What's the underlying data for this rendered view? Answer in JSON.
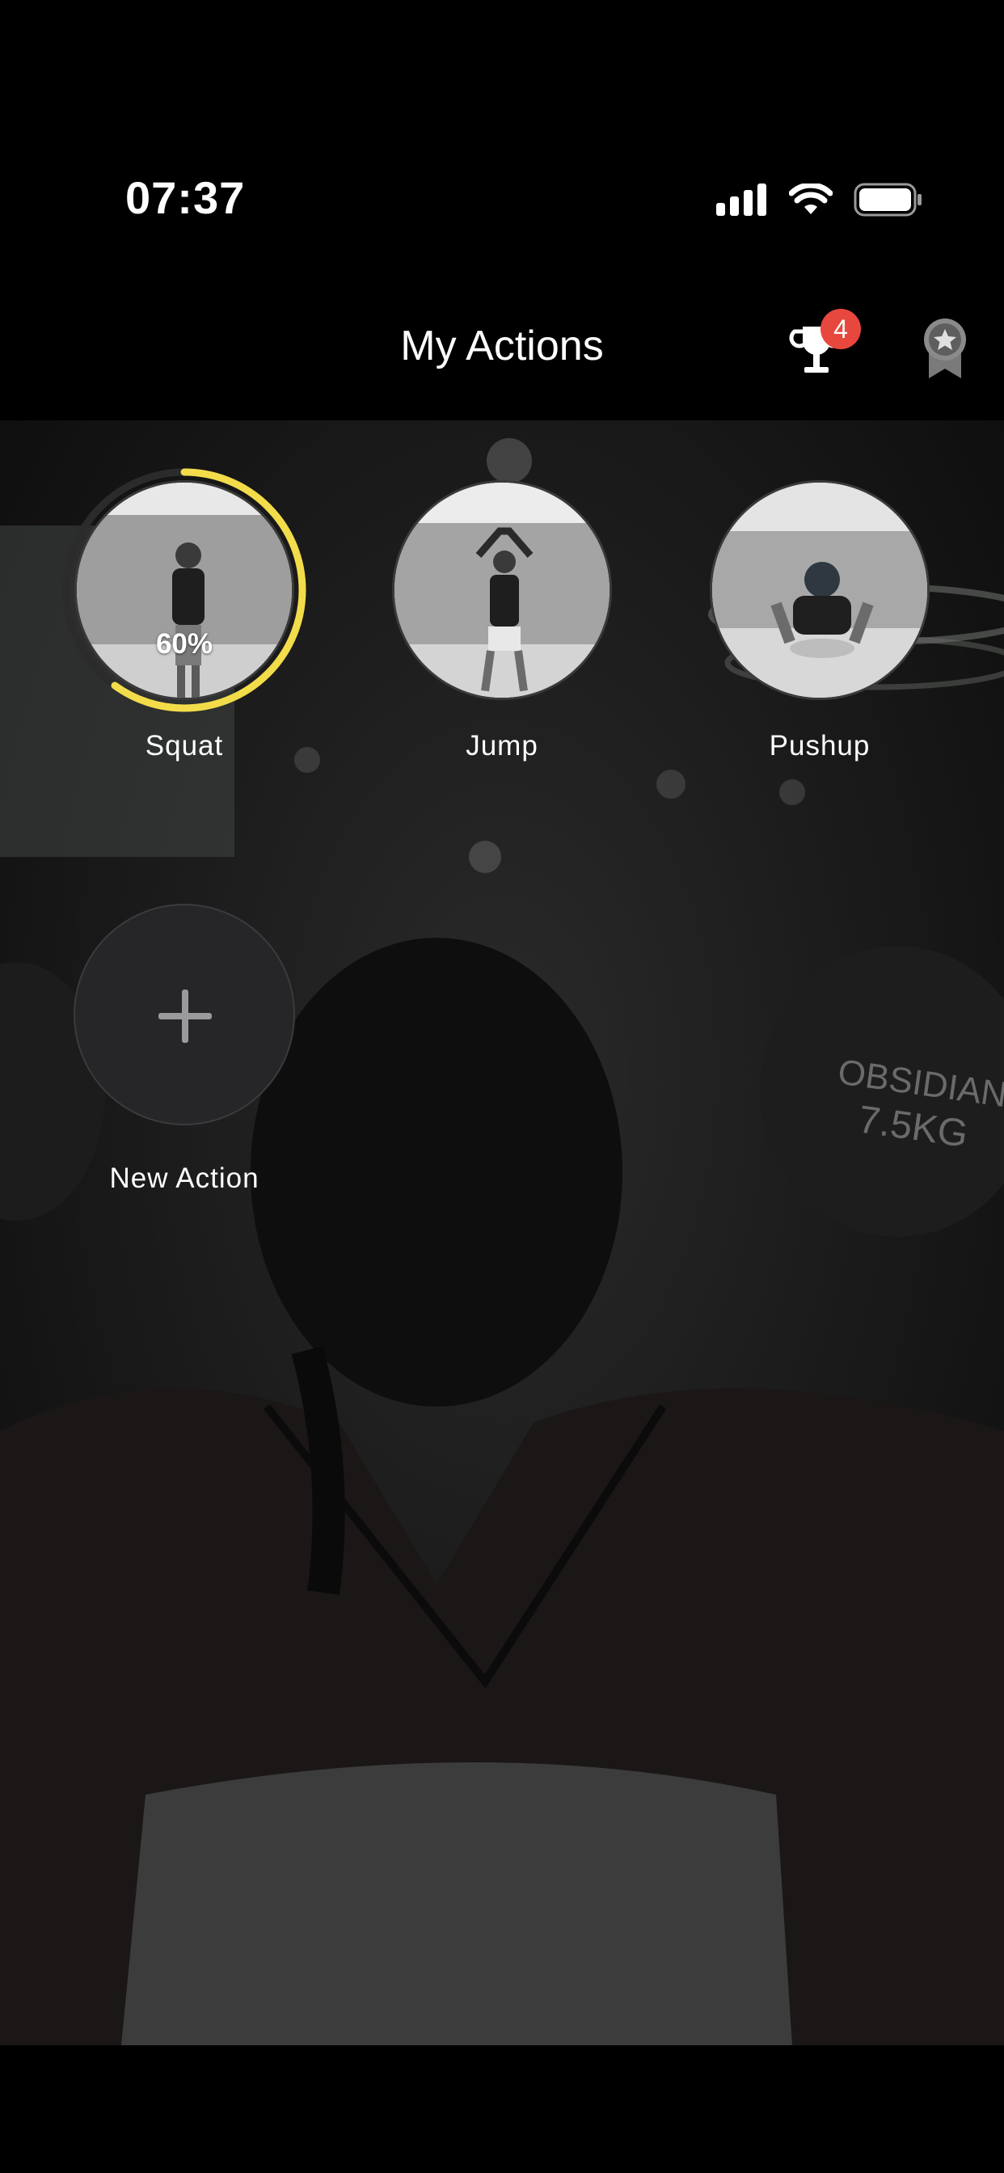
{
  "status": {
    "time": "07:37"
  },
  "header": {
    "title": "My Actions",
    "trophy_badge": "4"
  },
  "actions": [
    {
      "label": "Squat",
      "progress_text": "60%",
      "progress": 0.6
    },
    {
      "label": "Jump"
    },
    {
      "label": "Pushup"
    }
  ],
  "new_action": {
    "label": "New Action",
    "icon": "plus-icon"
  },
  "colors": {
    "accent": "#f2dc4a",
    "badge": "#e8473e",
    "background": "#000000"
  }
}
